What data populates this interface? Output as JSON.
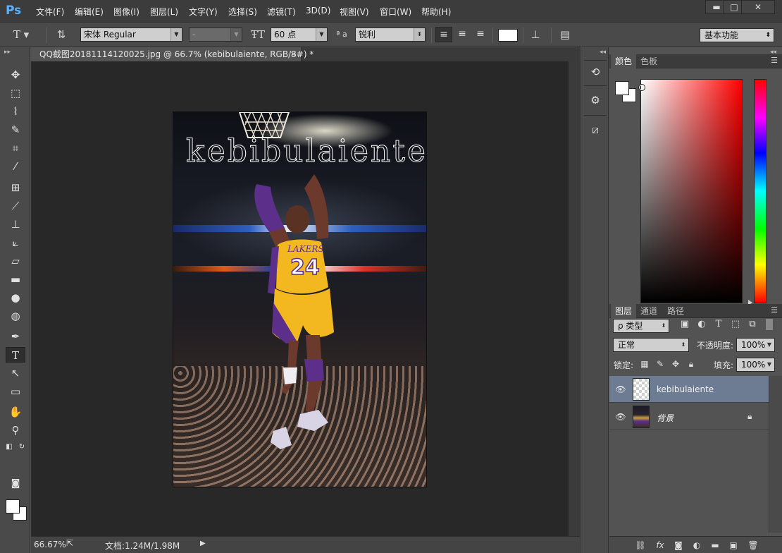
{
  "app": {
    "logo": "Ps"
  },
  "menu": [
    "文件(F)",
    "编辑(E)",
    "图像(I)",
    "图层(L)",
    "文字(Y)",
    "选择(S)",
    "滤镜(T)",
    "3D(D)",
    "视图(V)",
    "窗口(W)",
    "帮助(H)"
  ],
  "window_controls": {
    "minimize": "▬",
    "maximize": "□",
    "close": "✕"
  },
  "options": {
    "tool_icon": "T",
    "font_family": "宋体 Regular",
    "font_style": "-",
    "font_size": "60 点",
    "aa_label": "ª a",
    "antialias": "锐利",
    "workspace": "基本功能"
  },
  "document": {
    "tab_title": "QQ截图20181114120025.jpg @ 66.7% (kebibulaiente, RGB/8#) *",
    "tab_close": "×",
    "overlay_text": "kebibulaiente"
  },
  "status": {
    "zoom": "66.67%",
    "doc_info": "文档:1.24M/1.98M"
  },
  "color_panel": {
    "tabs": [
      "颜色",
      "色板"
    ]
  },
  "layers_panel": {
    "tabs": [
      "图层",
      "通道",
      "路径"
    ],
    "filter_kind": "ρ 类型",
    "blend_mode": "正常",
    "opacity_label": "不透明度:",
    "opacity": "100%",
    "lock_label": "锁定:",
    "fill_label": "填充:",
    "fill": "100%",
    "layers": [
      {
        "name": "kebibulaiente",
        "selected": true
      },
      {
        "name": "背景",
        "locked": true
      }
    ]
  },
  "colors": {
    "selected_layer": "#6d7b93",
    "accent": "#5ab2ff"
  }
}
